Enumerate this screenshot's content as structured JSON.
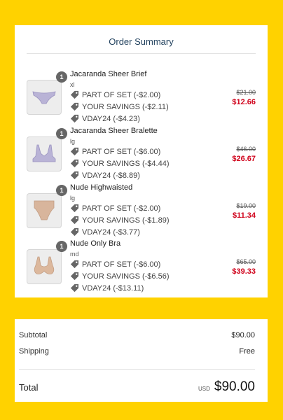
{
  "summary": {
    "title": "Order Summary"
  },
  "items": [
    {
      "qty": "1",
      "name": "Jacaranda Sheer Brief",
      "size": "xl",
      "image_icon": "brief-icon",
      "image_color": "#b9b3d6",
      "discounts": [
        "PART OF SET (-$2.00)",
        "YOUR SAVINGS (-$2.11)",
        "VDAY24 (-$4.23)"
      ],
      "original_price": "$21.00",
      "final_price": "$12.66"
    },
    {
      "qty": "1",
      "name": "Jacaranda Sheer Bralette",
      "size": "lg",
      "image_icon": "bralette-icon",
      "image_color": "#b9b3d6",
      "discounts": [
        "PART OF SET (-$6.00)",
        "YOUR SAVINGS (-$4.44)",
        "VDAY24 (-$8.89)"
      ],
      "original_price": "$46.00",
      "final_price": "$26.67"
    },
    {
      "qty": "1",
      "name": "Nude Highwaisted",
      "size": "lg",
      "image_icon": "highwaisted-icon",
      "image_color": "#d8b59c",
      "discounts": [
        "PART OF SET (-$2.00)",
        "YOUR SAVINGS (-$1.89)",
        "VDAY24 (-$3.77)"
      ],
      "original_price": "$19.00",
      "final_price": "$11.34"
    },
    {
      "qty": "1",
      "name": "Nude Only Bra",
      "size": "md",
      "image_icon": "bra-icon",
      "image_color": "#dcb89d",
      "discounts": [
        "PART OF SET (-$6.00)",
        "YOUR SAVINGS (-$6.56)",
        "VDAY24 (-$13.11)"
      ],
      "original_price": "$65.00",
      "final_price": "$39.33"
    }
  ],
  "totals": {
    "subtotal_label": "Subtotal",
    "subtotal_value": "$90.00",
    "shipping_label": "Shipping",
    "shipping_value": "Free",
    "total_label": "Total",
    "currency": "USD",
    "total_value": "$90.00"
  },
  "colors": {
    "background": "#FFD200",
    "sale_price": "#d0021b",
    "title": "#1f3f5c"
  }
}
